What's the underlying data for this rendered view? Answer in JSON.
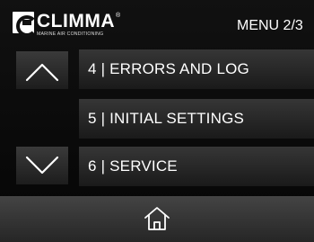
{
  "header": {
    "brand": "CLIMMA",
    "brand_mark": "®",
    "tagline": "MARINE AIR CONDITIONING",
    "menu_page": "MENU 2/3"
  },
  "menu": {
    "items": [
      {
        "label": "4 | ERRORS AND LOG"
      },
      {
        "label": "5 | INITIAL SETTINGS"
      },
      {
        "label": "6 | SERVICE"
      }
    ]
  },
  "icons": {
    "up": "chevron-up-icon",
    "down": "chevron-down-icon",
    "home": "home-icon"
  },
  "colors": {
    "background": "#0a0a0a",
    "button": "#2a2a2a",
    "text": "#ffffff"
  }
}
